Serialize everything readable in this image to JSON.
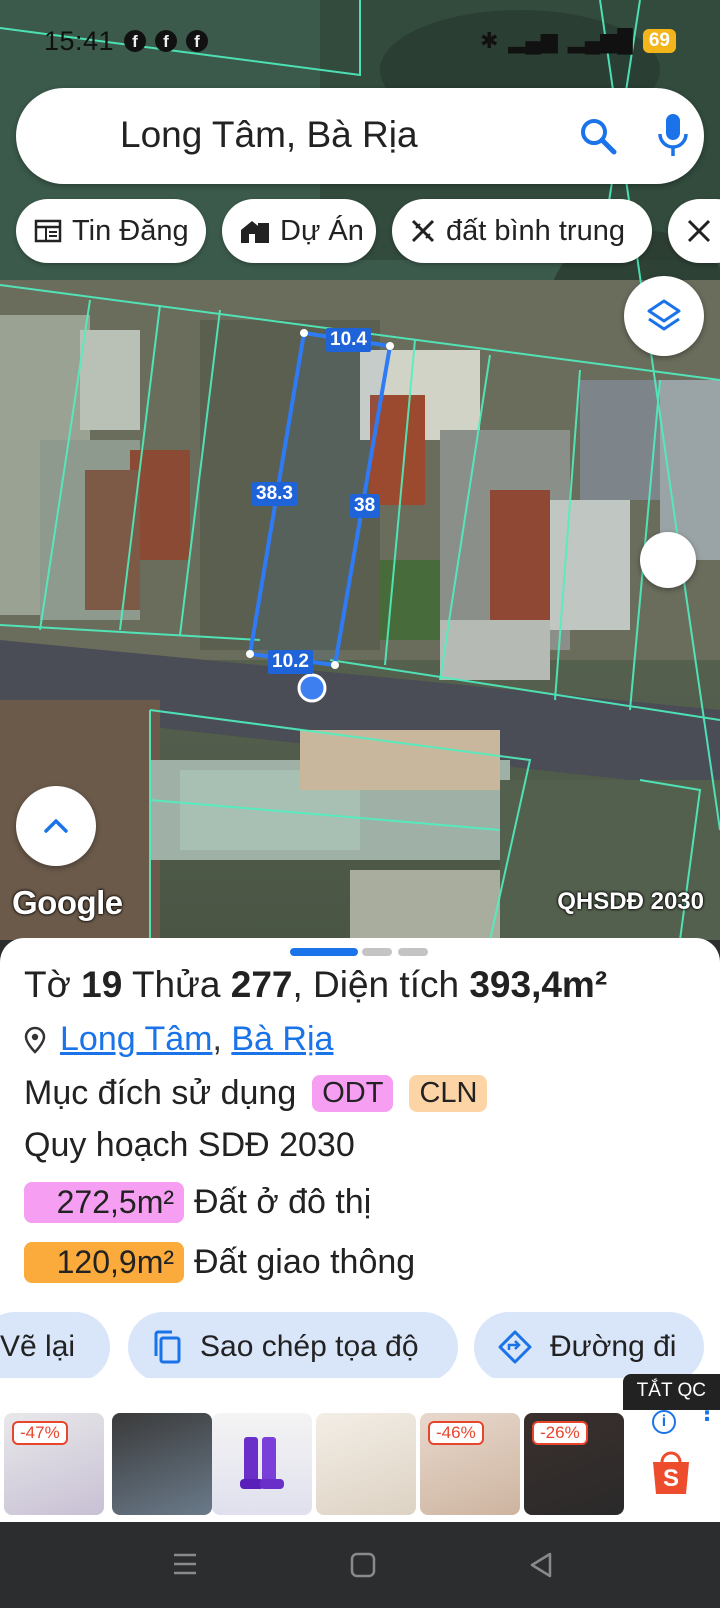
{
  "status_bar": {
    "time": "15:41",
    "notification_icons": [
      "facebook-icon",
      "facebook-icon",
      "facebook-icon"
    ],
    "battery": "69"
  },
  "search": {
    "query": "Long Tâm, Bà Rịa"
  },
  "chips": [
    {
      "label": "Tin Đăng",
      "icon": "news-icon"
    },
    {
      "label": "Dự Án",
      "icon": "building-icon"
    },
    {
      "label": "đất bình trung",
      "icon": "ruler-pencil-icon"
    }
  ],
  "map": {
    "dimensions": [
      "10.4",
      "38.3",
      "38",
      "10.2"
    ],
    "attribution": "Google",
    "layer_label": "QHSDĐ 2030"
  },
  "parcel": {
    "to_label": "Tờ",
    "to_value": "19",
    "thua_label": "Thửa",
    "thua_value": "277",
    "area_label": ", Diện tích",
    "area_value": "393,4m²",
    "location_part1": "Long Tâm",
    "location_sep": ",",
    "location_part2": "Bà Rịa",
    "purpose_label": "Mục đích sử dụng",
    "purpose_tags": [
      {
        "code": "ODT",
        "color": "#f59ef2"
      },
      {
        "code": "CLN",
        "color": "#fcd4a6"
      }
    ],
    "plan_title": "Quy hoạch SDĐ 2030",
    "plan_areas": [
      {
        "area": "272,5m²",
        "label": "Đất ở đô thị",
        "color": "#f59ef2"
      },
      {
        "area": "120,9m²",
        "label": "Đất giao thông",
        "color": "#fbaa3c"
      }
    ]
  },
  "actions": {
    "redraw": "Vẽ lại",
    "copy_coords": "Sao chép tọa độ",
    "directions": "Đường đi"
  },
  "ad": {
    "close_label": "TẮT QC",
    "discounts": [
      "-47%",
      "-46%",
      "-26%"
    ]
  },
  "colors": {
    "accent": "#1a73e8",
    "parcel_outline": "#2f7bf5",
    "cadastral_lines": "#4ff0c0"
  }
}
